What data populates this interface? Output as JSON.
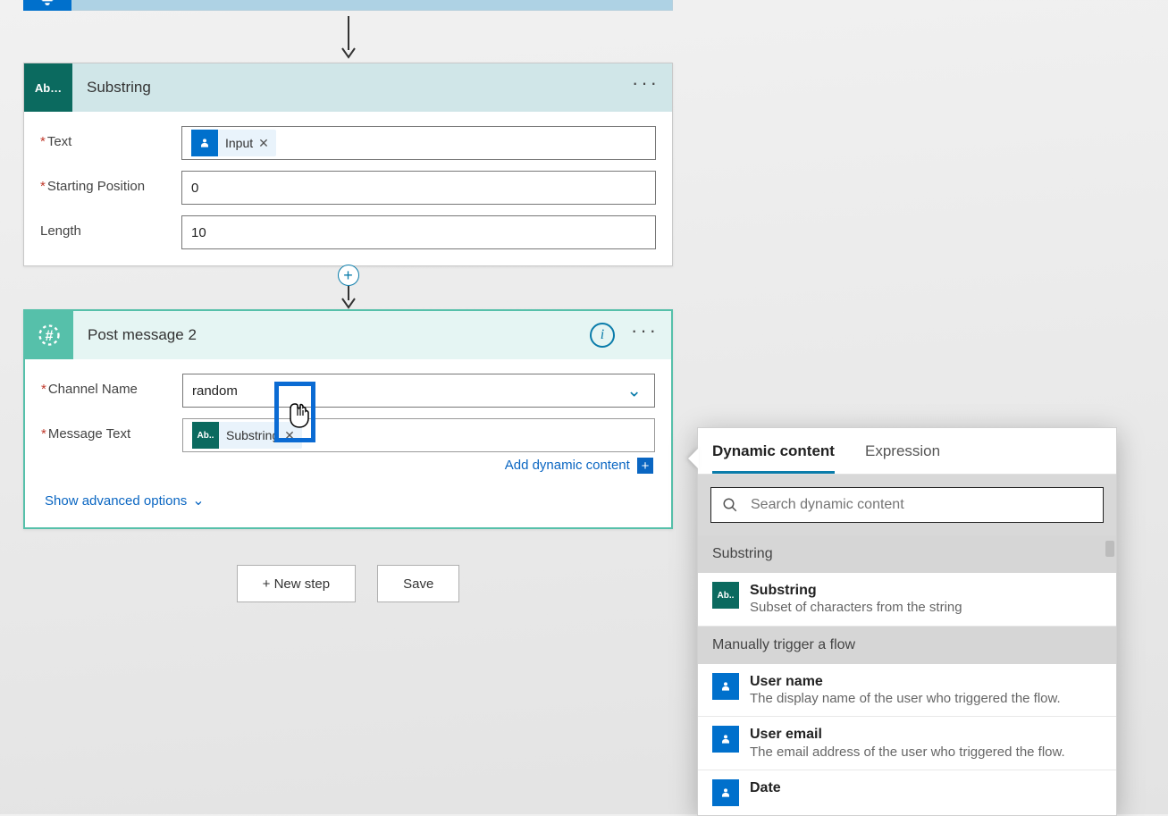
{
  "colors": {
    "teal": "#0b6a5f",
    "blue": "#0070cc",
    "slack": "#56c0aa",
    "link": "#0a66c2"
  },
  "cards": {
    "substring": {
      "title": "Substring",
      "icon_label": "Ab…",
      "fields": {
        "text": {
          "label": "Text",
          "token": {
            "label": "Input",
            "icon": "trigger-icon"
          }
        },
        "starting_position": {
          "label": "Starting Position",
          "value": "0"
        },
        "length": {
          "label": "Length",
          "value": "10"
        }
      }
    },
    "post_message": {
      "title": "Post message 2",
      "fields": {
        "channel_name": {
          "label": "Channel Name",
          "value": "random"
        },
        "message_text": {
          "label": "Message Text",
          "token": {
            "label": "Substring",
            "icon": "substring-icon"
          }
        }
      },
      "add_dynamic_label": "Add dynamic content",
      "show_advanced_label": "Show advanced options"
    }
  },
  "footer": {
    "new_step": "+ New step",
    "save": "Save"
  },
  "dc_panel": {
    "tabs": {
      "dynamic": "Dynamic content",
      "expression": "Expression"
    },
    "search_placeholder": "Search dynamic content",
    "sections": {
      "substring_h": "Substring",
      "substring_item": {
        "title": "Substring",
        "desc": "Subset of characters from the string"
      },
      "manual_h": "Manually trigger a flow",
      "user_name": {
        "title": "User name",
        "desc": "The display name of the user who triggered the flow."
      },
      "user_email": {
        "title": "User email",
        "desc": "The email address of the user who triggered the flow."
      },
      "date": {
        "title": "Date"
      }
    }
  }
}
